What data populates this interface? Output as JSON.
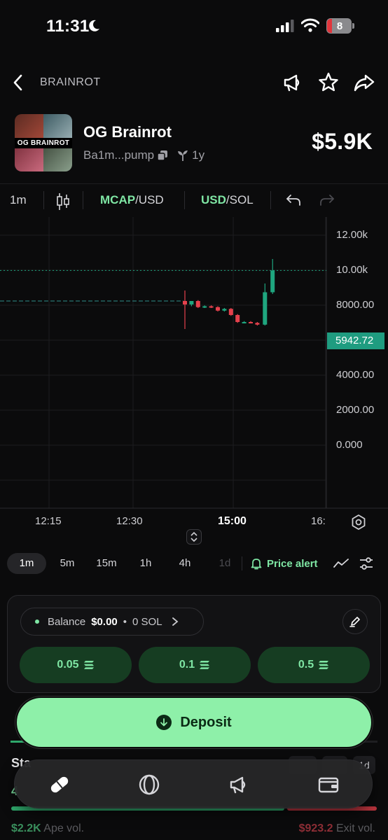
{
  "status_bar": {
    "time": "11:31",
    "battery": "8"
  },
  "nav": {
    "title": "BRAINROT",
    "icons": [
      "back-icon",
      "megaphone-icon",
      "star-icon",
      "share-icon"
    ]
  },
  "token": {
    "image_label": "OG BRAINROT",
    "name": "OG Brainrot",
    "address": "Ba1m...pump",
    "age": "1y",
    "price": "$5.9K"
  },
  "chart_toolbar": {
    "interval": "1m",
    "mcap": "MCAP",
    "mcap_suffix": "/USD",
    "usd": "USD",
    "usd_suffix": "/SOL"
  },
  "chart_data": {
    "type": "candlestick",
    "y_tick_labels": [
      "12.00k",
      "10.00k",
      "8000.00",
      "4000.00",
      "2000.00",
      "0.000"
    ],
    "x_tick_labels": [
      "12:15",
      "12:30",
      "15:00",
      "16:"
    ],
    "current_value_label": "5942.72",
    "current_value": 5942.72,
    "ylim": [
      -2500,
      12000
    ],
    "candles": [
      {
        "o": 4200,
        "h": 4800,
        "l": 2600,
        "c": 4000,
        "dir": "down"
      },
      {
        "o": 4000,
        "h": 4200,
        "l": 3900,
        "c": 4200,
        "dir": "up"
      },
      {
        "o": 4200,
        "h": 4250,
        "l": 3800,
        "c": 3850,
        "dir": "down"
      },
      {
        "o": 3850,
        "h": 3950,
        "l": 3800,
        "c": 3900,
        "dir": "up"
      },
      {
        "o": 3900,
        "h": 3950,
        "l": 3800,
        "c": 3850,
        "dir": "down"
      },
      {
        "o": 3850,
        "h": 3900,
        "l": 3600,
        "c": 3650,
        "dir": "down"
      },
      {
        "o": 3650,
        "h": 3800,
        "l": 3600,
        "c": 3750,
        "dir": "up"
      },
      {
        "o": 3750,
        "h": 3800,
        "l": 3350,
        "c": 3400,
        "dir": "down"
      },
      {
        "o": 3400,
        "h": 3450,
        "l": 2950,
        "c": 3000,
        "dir": "down"
      },
      {
        "o": 3000,
        "h": 3050,
        "l": 2950,
        "c": 3000,
        "dir": "up"
      },
      {
        "o": 3000,
        "h": 3050,
        "l": 2950,
        "c": 2950,
        "dir": "down"
      },
      {
        "o": 2950,
        "h": 3000,
        "l": 2800,
        "c": 2850,
        "dir": "down"
      },
      {
        "o": 2850,
        "h": 5200,
        "l": 2800,
        "c": 4700,
        "dir": "up"
      },
      {
        "o": 4700,
        "h": 6600,
        "l": 4600,
        "c": 5942.72,
        "dir": "up"
      }
    ],
    "colors": {
      "up": "#1fa67f",
      "down": "#e5414d"
    }
  },
  "timeframes": [
    {
      "label": "1m",
      "state": "active"
    },
    {
      "label": "5m",
      "state": "normal"
    },
    {
      "label": "15m",
      "state": "normal"
    },
    {
      "label": "1h",
      "state": "normal"
    },
    {
      "label": "4h",
      "state": "normal"
    },
    {
      "label": "1d",
      "state": "dim"
    }
  ],
  "price_alert": "Price alert",
  "trade": {
    "balance_label": "Balance",
    "balance_usd": "$0.00",
    "balance_sol": "0 SOL",
    "amounts": [
      "0.05",
      "0.1",
      "0.5"
    ]
  },
  "deposit_label": "Deposit",
  "stats": {
    "title": "Sta",
    "chip_1d": "1d",
    "row_value": "4",
    "ape_value": "$2.2K",
    "ape_label": "Ape vol.",
    "exit_value": "$923.2",
    "exit_label": "Exit vol."
  },
  "tabbar": {
    "icons": [
      "pill-icon",
      "circle-icon",
      "megaphone-icon",
      "wallet-icon"
    ]
  },
  "colors": {
    "accent": "#7fe6a4",
    "deposit": "#8ef0a9",
    "up": "#1fa67f",
    "down": "#e5414d"
  }
}
